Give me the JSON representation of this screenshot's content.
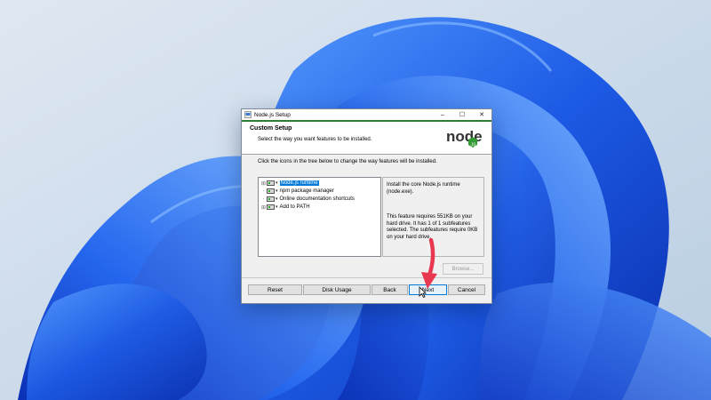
{
  "window": {
    "title": "Node.js Setup",
    "controls": {
      "minimize": "–",
      "maximize": "☐",
      "close": "✕"
    }
  },
  "header": {
    "title": "Custom Setup",
    "subtitle": "Select the way you want features to be installed."
  },
  "logo": {
    "text": "node"
  },
  "instructions": "Click the icons in the tree below to change the way features will be installed.",
  "tree": {
    "items": [
      {
        "label": "Node.js runtime",
        "selected": true
      },
      {
        "label": "npm package manager",
        "selected": false
      },
      {
        "label": "Online documentation shortcuts",
        "selected": false
      },
      {
        "label": "Add to PATH",
        "selected": false
      }
    ]
  },
  "description": {
    "line1": "Install the core Node.js runtime (node.exe).",
    "line2": "This feature requires 551KB on your hard drive. It has 1 of 1 subfeatures selected. The subfeatures require 0KB on your hard drive."
  },
  "buttons": {
    "browse": "Browse...",
    "reset": "Reset",
    "disk_usage": "Disk Usage",
    "back": "Back",
    "next": "Next",
    "cancel": "Cancel"
  },
  "colors": {
    "accent": "#0078d7",
    "node_green": "#339933",
    "arrow_red": "#e8384f",
    "wallpaper_blue": "#1f57e0"
  }
}
